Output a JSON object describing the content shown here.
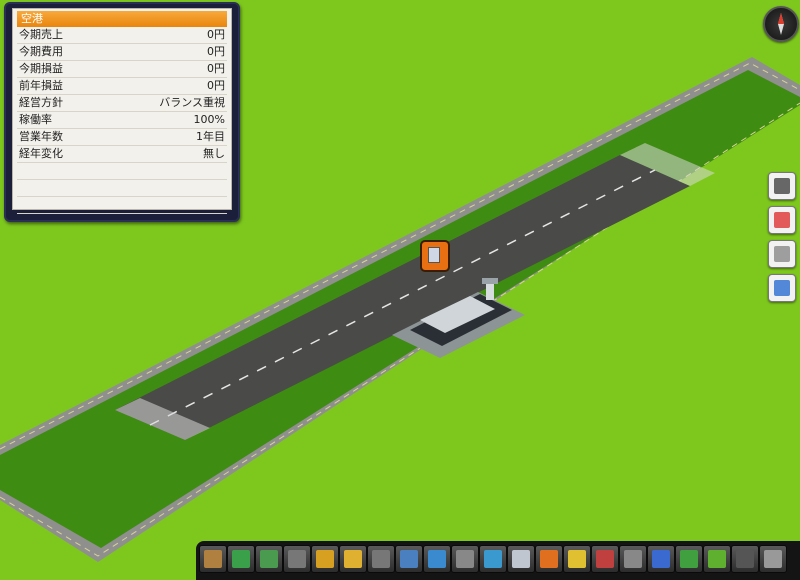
{
  "panel": {
    "title": "空港",
    "rows": [
      {
        "label": "今期売上",
        "value": "0円"
      },
      {
        "label": "今期費用",
        "value": "0円"
      },
      {
        "label": "今期損益",
        "value": "0円"
      },
      {
        "label": "前年損益",
        "value": "0円"
      },
      {
        "label": "経営方針",
        "value": "バランス重視"
      },
      {
        "label": "稼働率",
        "value": "100%"
      },
      {
        "label": "営業年数",
        "value": "1年目"
      },
      {
        "label": "経年変化",
        "value": "無し"
      }
    ]
  },
  "colors": {
    "grass": "#7ec81e",
    "field": "#3f8c12",
    "runway": "#4a4a48",
    "road": "#9a9a98",
    "panel_accent": "#e9850e"
  },
  "side_buttons": [
    "camera-icon",
    "calendar-list-icon",
    "document-icon",
    "graph-panel-icon"
  ],
  "toolbar_icons": [
    "rail-track-icon",
    "train-icon",
    "bus-icon",
    "road-icon",
    "truck-icon",
    "vehicle-icon",
    "highway-icon",
    "bridge-icon",
    "station-icon",
    "buildings-icon",
    "exchange-icon",
    "office-building-icon",
    "cargo-box-icon",
    "finance-icon",
    "stock-chart-icon",
    "calendar-icon",
    "settings-icon",
    "terrain-icon",
    "bulldozer-icon",
    "advisor-icon",
    "save-icon"
  ]
}
